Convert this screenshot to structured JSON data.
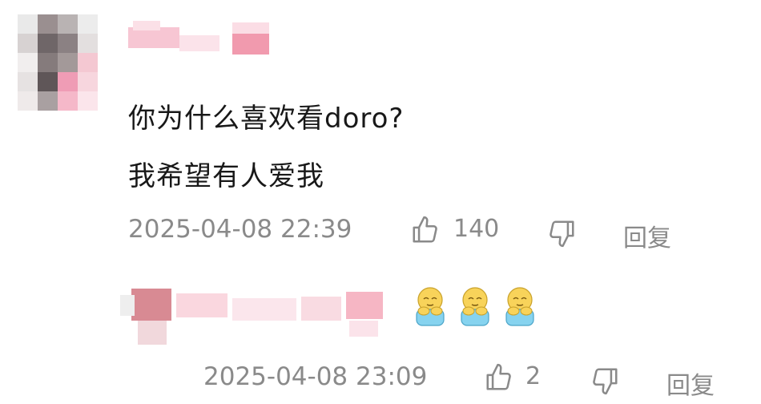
{
  "comment": {
    "lines": [
      "你为什么喜欢看doro?",
      "我希望有人爱我"
    ],
    "timestamp": "2025-04-08 22:39",
    "like_count": "140",
    "reply_label": "回复"
  },
  "reply": {
    "emoji_icon": "doro-hug-emoji",
    "timestamp": "2025-04-08 23:09",
    "like_count": "2",
    "reply_label": "回复"
  }
}
